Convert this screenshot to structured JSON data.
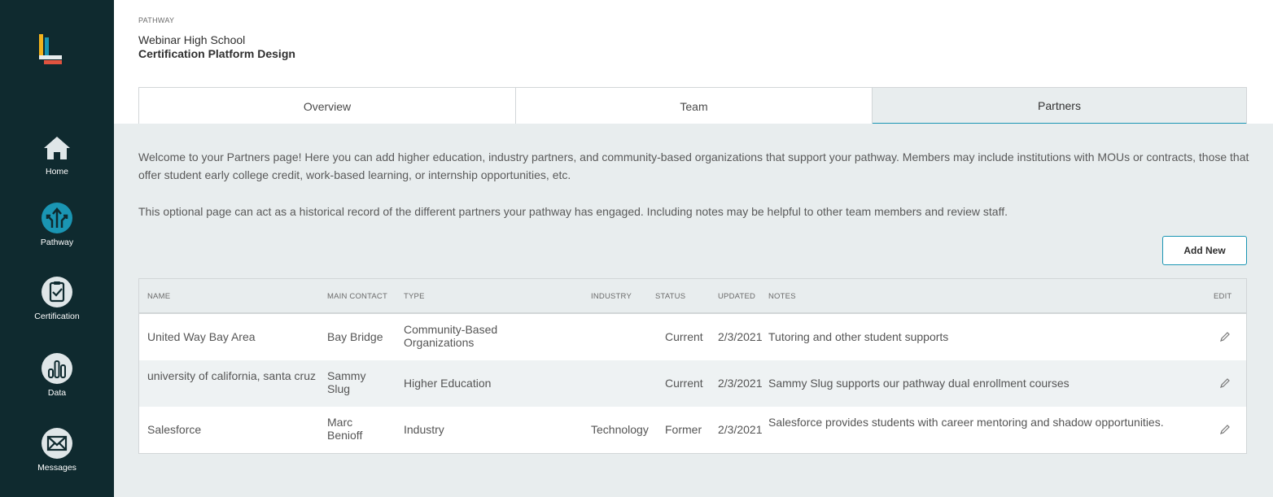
{
  "sidebar": {
    "items": [
      {
        "label": "Home",
        "icon": "home-icon"
      },
      {
        "label": "Pathway",
        "icon": "pathway-icon"
      },
      {
        "label": "Certification",
        "icon": "clipboard-check-icon"
      },
      {
        "label": "Data",
        "icon": "bar-chart-icon"
      },
      {
        "label": "Messages",
        "icon": "envelope-icon"
      }
    ],
    "active": "Pathway",
    "colors": {
      "background": "#0f2a2f",
      "accent": "#1a95b3"
    }
  },
  "header": {
    "eyebrow": "PATHWAY",
    "school": "Webinar High School",
    "pathway": "Certification Platform Design"
  },
  "tabs": [
    {
      "label": "Overview"
    },
    {
      "label": "Team"
    },
    {
      "label": "Partners"
    }
  ],
  "active_tab": "Partners",
  "intro": {
    "paragraph1": "Welcome to your Partners page! Here you can add higher education, industry partners, and community-based organizations that support your pathway. Members may include institutions with MOUs or contracts, those that offer student early college credit, work-based learning, or internship opportunities, etc.",
    "paragraph2": "This optional page can act as a historical record of the different partners your pathway has engaged. Including notes may be helpful to other team members and review staff."
  },
  "add_button": "Add New",
  "table": {
    "columns": [
      "NAME",
      "MAIN CONTACT",
      "TYPE",
      "INDUSTRY",
      "STATUS",
      "UPDATED",
      "NOTES",
      "EDIT"
    ],
    "rows": [
      {
        "name": "United Way Bay Area",
        "contact": "Bay Bridge",
        "type": "Community-Based Organizations",
        "industry": "",
        "status": "Current",
        "updated": "2/3/2021",
        "notes": "Tutoring and other student supports"
      },
      {
        "name": "university of california, santa cruz",
        "contact": "Sammy Slug",
        "type": "Higher Education",
        "industry": "",
        "status": "Current",
        "updated": "2/3/2021",
        "notes": "Sammy Slug supports our pathway dual enrollment courses"
      },
      {
        "name": "Salesforce",
        "contact": "Marc Benioff",
        "type": "Industry",
        "industry": "Technology",
        "status": "Former",
        "updated": "2/3/2021",
        "notes": "Salesforce provides students with career mentoring and shadow opportunities."
      }
    ]
  }
}
